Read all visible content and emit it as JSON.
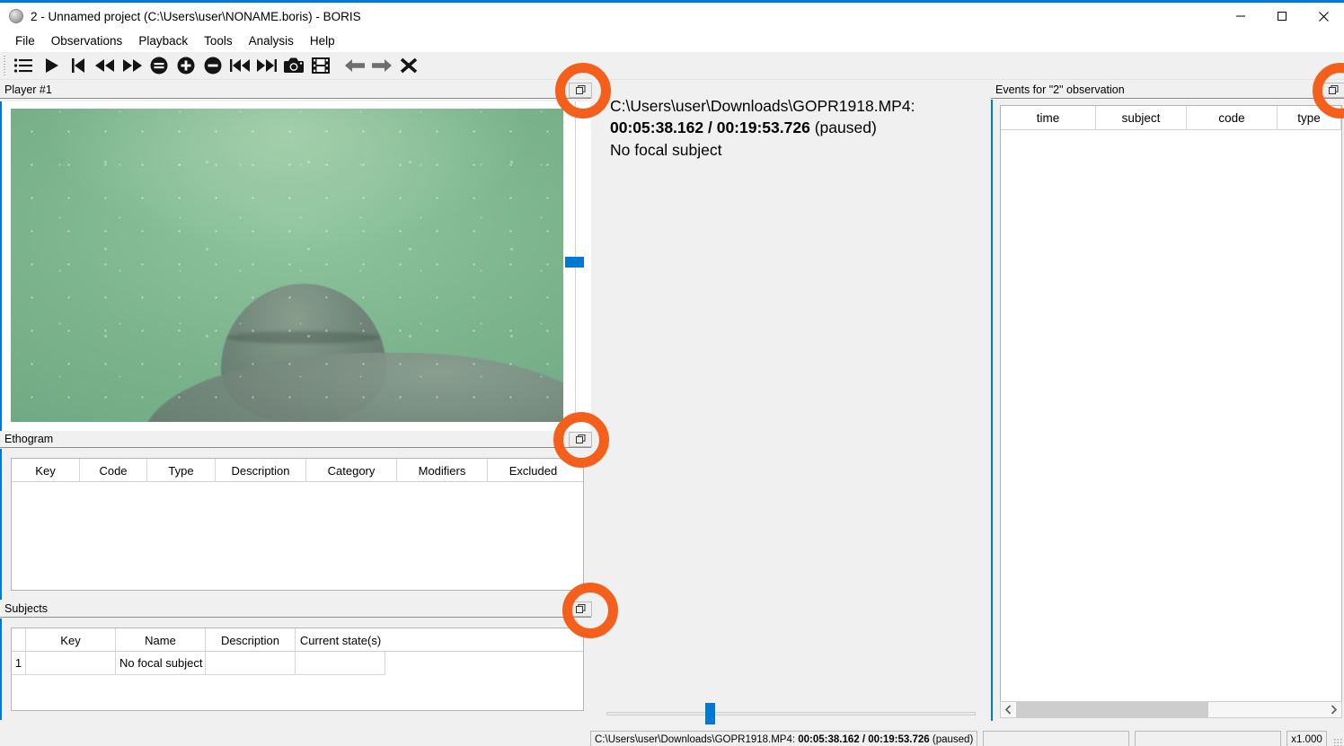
{
  "window": {
    "title": "2 - Unnamed project (C:\\Users\\user\\NONAME.boris) - BORIS",
    "app_icon": "boris-circle-icon",
    "controls": {
      "minimize": "minimize-icon",
      "maximize": "maximize-icon",
      "close": "close-icon"
    },
    "accent_color": "#0078d7",
    "annotation_color": "#f4601c"
  },
  "menubar": {
    "items": [
      {
        "label": "File"
      },
      {
        "label": "Observations"
      },
      {
        "label": "Playback"
      },
      {
        "label": "Tools"
      },
      {
        "label": "Analysis"
      },
      {
        "label": "Help"
      }
    ]
  },
  "toolbar": {
    "buttons": [
      {
        "name": "observations-list",
        "icon": "list-icon"
      },
      {
        "name": "play",
        "icon": "play-icon"
      },
      {
        "name": "jump-to-start",
        "icon": "skip-start-icon"
      },
      {
        "name": "rewind",
        "icon": "rewind-icon"
      },
      {
        "name": "fast-forward",
        "icon": "fast-forward-icon"
      },
      {
        "name": "reset-zoom",
        "icon": "circle-minus-thick-icon"
      },
      {
        "name": "zoom-in",
        "icon": "circle-plus-icon"
      },
      {
        "name": "zoom-out",
        "icon": "circle-minus-icon"
      },
      {
        "name": "previous-media",
        "icon": "skip-previous-icon"
      },
      {
        "name": "next-media",
        "icon": "skip-next-icon"
      },
      {
        "name": "snapshot",
        "icon": "camera-icon"
      },
      {
        "name": "frame-by-frame",
        "icon": "film-icon"
      },
      {
        "name": "step-backward",
        "icon": "arrow-left-icon"
      },
      {
        "name": "step-forward",
        "icon": "arrow-right-icon"
      },
      {
        "name": "close-observation",
        "icon": "x-icon"
      }
    ]
  },
  "player": {
    "panel_title": "Player #1",
    "float_icon": "restore-window-icon",
    "video_description": "underwater-manatee-video-frame"
  },
  "media_info": {
    "file_line": "C:\\Users\\user\\Downloads\\GOPR1918.MP4:",
    "position": "00:05:38.162",
    "separator": " / ",
    "duration": "00:19:53.726",
    "state": "(paused)",
    "focal_subject": "No focal subject"
  },
  "seek": {
    "name": "media-position-slider",
    "value_percent": 28
  },
  "ethogram": {
    "panel_title": "Ethogram",
    "float_icon": "restore-window-icon",
    "columns": [
      "Key",
      "Code",
      "Type",
      "Description",
      "Category",
      "Modifiers",
      "Excluded"
    ],
    "rows": []
  },
  "subjects": {
    "panel_title": "Subjects",
    "float_icon": "restore-window-icon",
    "columns": [
      "",
      "Key",
      "Name",
      "Description",
      "Current state(s)"
    ],
    "rows": [
      {
        "index": "1",
        "key": "",
        "name": "No focal subject",
        "description": "",
        "current_states": ""
      }
    ]
  },
  "events": {
    "panel_title": "Events for \"2\" observation",
    "float_icon": "restore-window-icon",
    "columns": [
      "time",
      "subject",
      "code",
      "type"
    ],
    "rows": [],
    "scrollbar": {
      "left_arrow": "chevron-left-icon",
      "right_arrow": "chevron-right-icon",
      "thumb_percent": 62
    }
  },
  "statusbar": {
    "media_path": "C:\\Users\\user\\Downloads\\GOPR1918.MP4:",
    "time_bold": "00:05:38.162 / 00:19:53.726",
    "state": "(paused)",
    "field2": "",
    "field3": "",
    "playback_rate": "x1.000"
  },
  "annotations": {
    "rings": [
      {
        "name": "highlight-ring-player-float"
      },
      {
        "name": "highlight-ring-ethogram-float"
      },
      {
        "name": "highlight-ring-subjects-float"
      },
      {
        "name": "highlight-ring-events-float"
      }
    ]
  }
}
